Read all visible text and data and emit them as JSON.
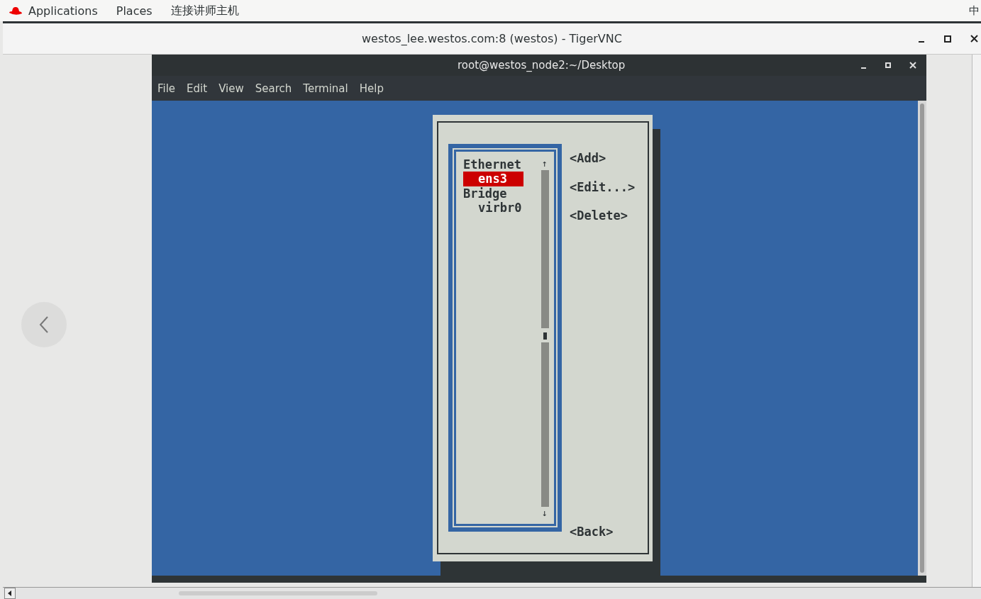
{
  "top_bar": {
    "menus": [
      "Applications",
      "Places",
      "连接讲师主机"
    ],
    "input_indicator": "中"
  },
  "vnc_window": {
    "title": "westos_lee.westos.com:8 (westos) - TigerVNC"
  },
  "terminal": {
    "title": "root@westos_node2:~/Desktop",
    "menu": [
      "File",
      "Edit",
      "View",
      "Search",
      "Terminal",
      "Help"
    ]
  },
  "nmtui": {
    "connections": [
      {
        "label": "Ethernet",
        "kind": "header"
      },
      {
        "label": "ens3",
        "kind": "item",
        "selected": true
      },
      {
        "label": "Bridge",
        "kind": "header"
      },
      {
        "label": "virbr0",
        "kind": "item",
        "selected": false
      }
    ],
    "scroll_up": "↑",
    "scroll_down": "↓",
    "buttons": [
      "<Add>",
      "<Edit...>",
      "<Delete>"
    ],
    "back_button": "<Back>"
  }
}
